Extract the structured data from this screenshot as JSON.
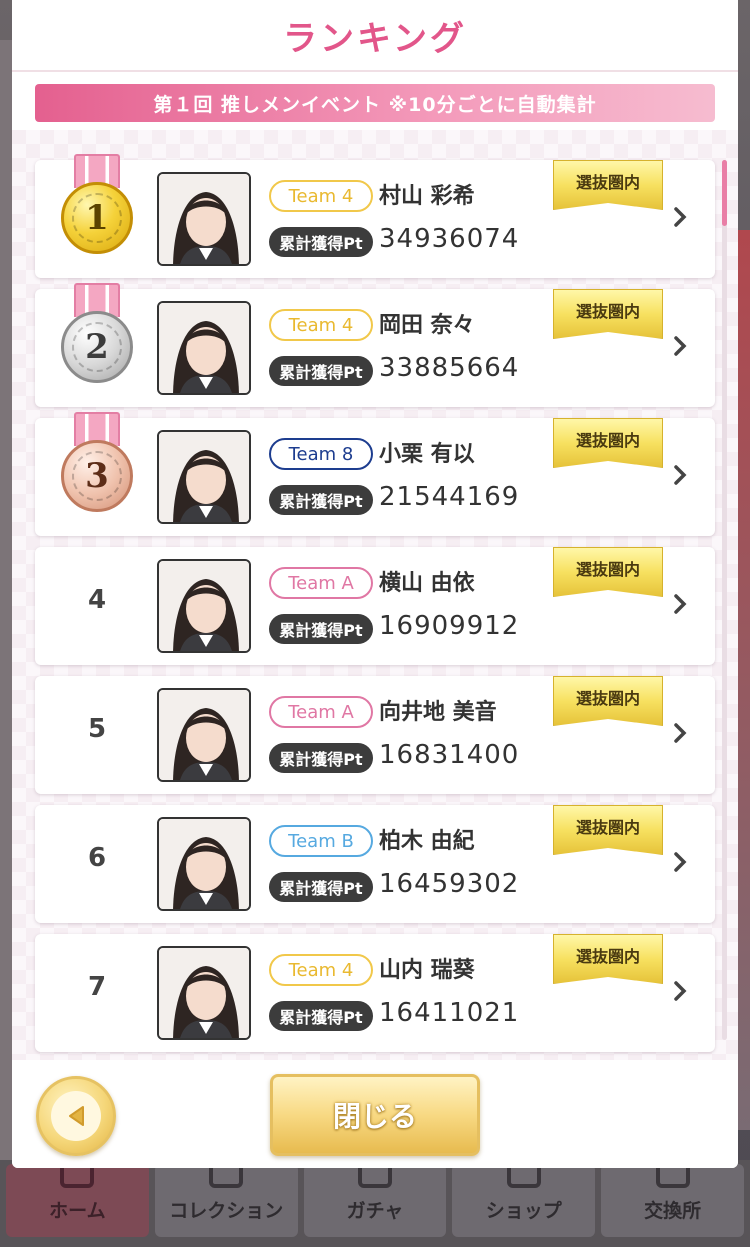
{
  "modal": {
    "title": "ランキング",
    "event_banner": "第１回 推しメンイベント ※10分ごとに自動集計",
    "close_label": "閉じる"
  },
  "ranking": [
    {
      "rank": "1",
      "team": "Team 4",
      "team_color": "#f1c84a",
      "name": "村山 彩希",
      "pt_label": "累計獲得Pt",
      "points": "34936074",
      "badge": "選抜圏内",
      "medal": "gold"
    },
    {
      "rank": "2",
      "team": "Team 4",
      "team_color": "#f1c84a",
      "name": "岡田 奈々",
      "pt_label": "累計獲得Pt",
      "points": "33885664",
      "badge": "選抜圏内",
      "medal": "silver"
    },
    {
      "rank": "3",
      "team": "Team 8",
      "team_color": "#1d3d8f",
      "name": "小栗 有以",
      "pt_label": "累計獲得Pt",
      "points": "21544169",
      "badge": "選抜圏内",
      "medal": "bronze"
    },
    {
      "rank": "4",
      "team": "Team A",
      "team_color": "#e077a4",
      "name": "横山 由依",
      "pt_label": "累計獲得Pt",
      "points": "16909912",
      "badge": "選抜圏内"
    },
    {
      "rank": "5",
      "team": "Team A",
      "team_color": "#e077a4",
      "name": "向井地 美音",
      "pt_label": "累計獲得Pt",
      "points": "16831400",
      "badge": "選抜圏内"
    },
    {
      "rank": "6",
      "team": "Team B",
      "team_color": "#56a9e0",
      "name": "柏木 由紀",
      "pt_label": "累計獲得Pt",
      "points": "16459302",
      "badge": "選抜圏内"
    },
    {
      "rank": "7",
      "team": "Team 4",
      "team_color": "#f1c84a",
      "name": "山内 瑞葵",
      "pt_label": "累計獲得Pt",
      "points": "16411021",
      "badge": "選抜圏内"
    }
  ],
  "tabbar": {
    "items": [
      {
        "label": "ホーム",
        "icon": "home-icon"
      },
      {
        "label": "コレクション",
        "icon": "collection-icon"
      },
      {
        "label": "ガチャ",
        "icon": "gacha-icon"
      },
      {
        "label": "ショップ",
        "icon": "shop-cart-icon"
      },
      {
        "label": "交換所",
        "icon": "exchange-icon"
      }
    ]
  },
  "colors": {
    "accent_pink": "#e2568a",
    "gold_button": "#f8d983"
  }
}
